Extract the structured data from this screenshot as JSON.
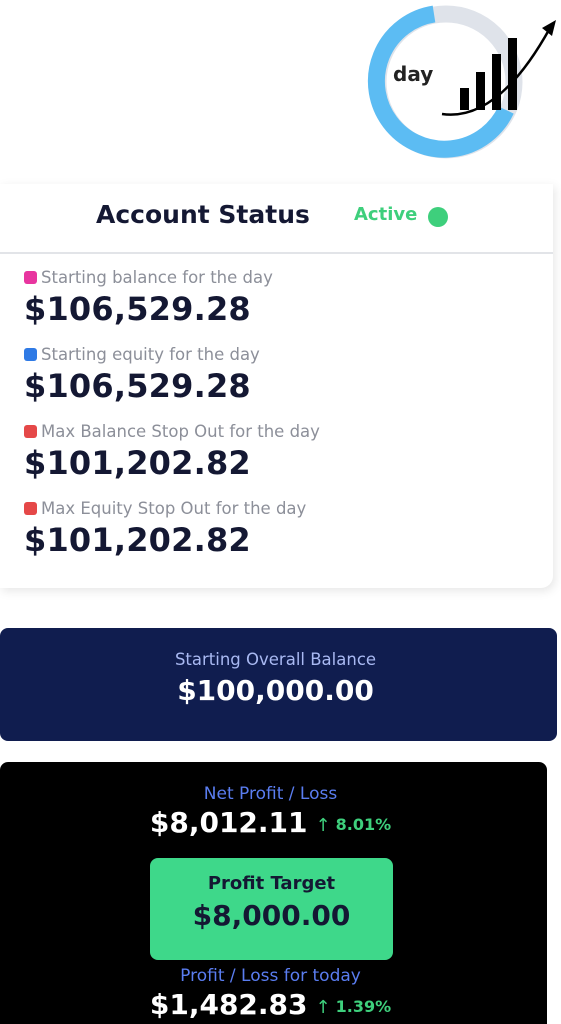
{
  "ring": {
    "label": "day",
    "color_fill": "#5cbcf3",
    "color_track": "#dfe3ea"
  },
  "account_status": {
    "title": "Account Status",
    "status": "Active",
    "status_color": "#3ecf7c",
    "items": [
      {
        "label": "Starting balance for the day",
        "value": "$106,529.28",
        "marker_color": "#e8359f"
      },
      {
        "label": "Starting equity for the day",
        "value": "$106,529.28",
        "marker_color": "#2f7ae5"
      },
      {
        "label": "Max Balance Stop Out for the day",
        "value": "$101,202.82",
        "marker_color": "#e54848"
      },
      {
        "label": "Max Equity Stop Out for the day",
        "value": "$101,202.82",
        "marker_color": "#e54848"
      }
    ]
  },
  "overall": {
    "label": "Starting Overall Balance",
    "value": "$100,000.00",
    "bg_color": "#101d4f"
  },
  "profit": {
    "net_label": "Net Profit / Loss",
    "net_value": "$8,012.11",
    "net_arrow": "↑",
    "net_percent": "8.01%",
    "target_label": "Profit Target",
    "target_value": "$8,000.00",
    "target_color": "#3ed88a",
    "today_label": "Profit / Loss for today",
    "today_value": "$1,482.83",
    "today_arrow": "↑",
    "today_percent": "1.39%"
  }
}
